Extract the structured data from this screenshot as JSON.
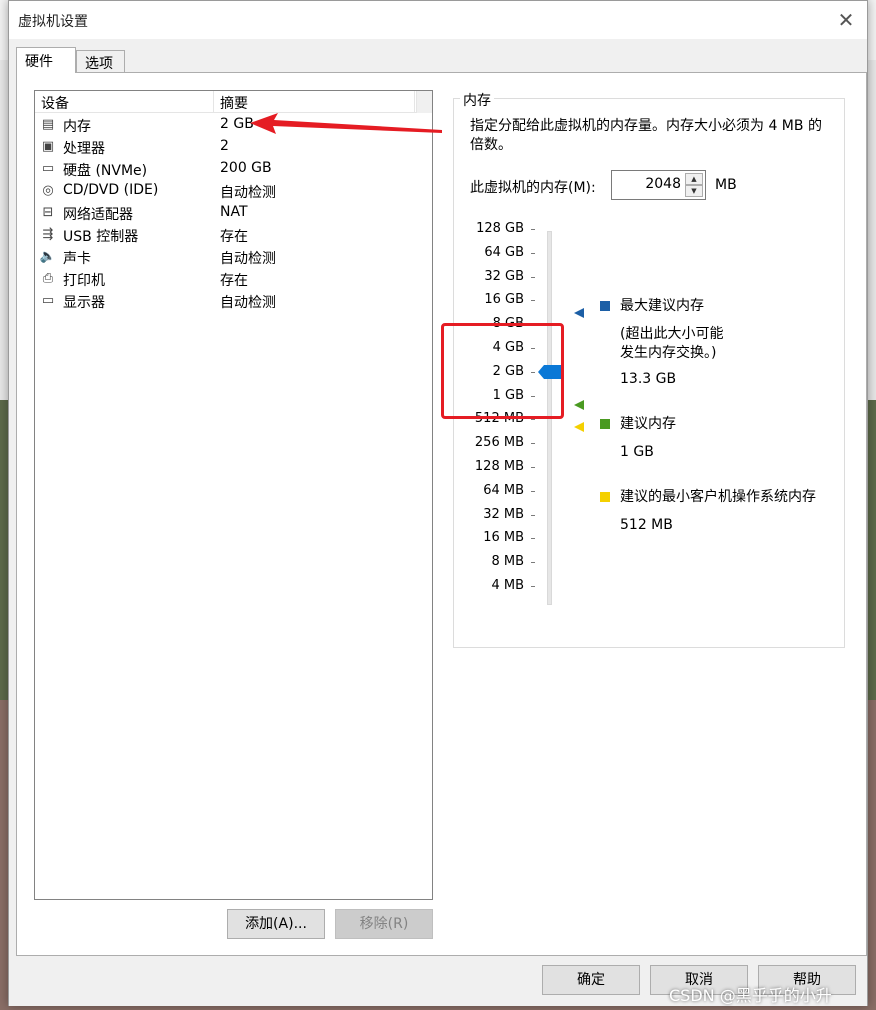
{
  "window": {
    "title": "虚拟机设置",
    "close_glyph": "✕"
  },
  "tabs": [
    {
      "label": "硬件",
      "active": true
    },
    {
      "label": "选项",
      "active": false
    }
  ],
  "device_table": {
    "columns": [
      "设备",
      "摘要"
    ],
    "rows": [
      {
        "icon": "memory-icon",
        "glyph": "▤",
        "name": "内存",
        "summary": "2 GB"
      },
      {
        "icon": "processor-icon",
        "glyph": "▣",
        "name": "处理器",
        "summary": "2"
      },
      {
        "icon": "hard-disk-icon",
        "glyph": "▭",
        "name": "硬盘 (NVMe)",
        "summary": "200 GB"
      },
      {
        "icon": "cd-dvd-icon",
        "glyph": "◎",
        "name": "CD/DVD (IDE)",
        "summary": "自动检测"
      },
      {
        "icon": "network-adapter-icon",
        "glyph": "⊟",
        "name": "网络适配器",
        "summary": "NAT"
      },
      {
        "icon": "usb-icon",
        "glyph": "⇶",
        "name": "USB 控制器",
        "summary": "存在"
      },
      {
        "icon": "speaker-icon",
        "glyph": "🔈",
        "name": "声卡",
        "summary": "自动检测"
      },
      {
        "icon": "printer-icon",
        "glyph": "⎙",
        "name": "打印机",
        "summary": "存在"
      },
      {
        "icon": "display-icon",
        "glyph": "▭",
        "name": "显示器",
        "summary": "自动检测"
      }
    ]
  },
  "buttons": {
    "add": "添加(A)...",
    "remove": "移除(R)",
    "ok": "确定",
    "cancel": "取消",
    "help": "帮助"
  },
  "memory": {
    "group_title": "内存",
    "description": "指定分配给此虚拟机的内存量。内存大小必须为 4 MB 的倍数。",
    "label": "此虚拟机的内存(M):",
    "value": "2048",
    "unit": "MB",
    "spin_up_glyph": "▲",
    "spin_down_glyph": "▼",
    "slider_ticks": [
      "128 GB",
      "64 GB",
      "32 GB",
      "16 GB",
      "8 GB",
      "4 GB",
      "2 GB",
      "1 GB",
      "512 MB",
      "256 MB",
      "128 MB",
      "64 MB",
      "32 MB",
      "16 MB",
      "8 MB",
      "4 MB"
    ],
    "current_tick": "2 GB",
    "legend": {
      "max_title": "最大建议内存",
      "max_note_line1": "(超出此大小可能",
      "max_note_line2": "发生内存交换。)",
      "max_value": "13.3 GB",
      "recommended_title": "建议内存",
      "recommended_value": "1 GB",
      "min_title": "建议的最小客户机操作系统内存",
      "min_value": "512 MB"
    },
    "colors": {
      "max": "#1c5fa6",
      "recommended": "#4a9a21",
      "min": "#f4d000",
      "thumb": "#0a78d6",
      "annotation": "#e51c23"
    }
  },
  "watermark": "CSDN @黑乎乎的小升"
}
